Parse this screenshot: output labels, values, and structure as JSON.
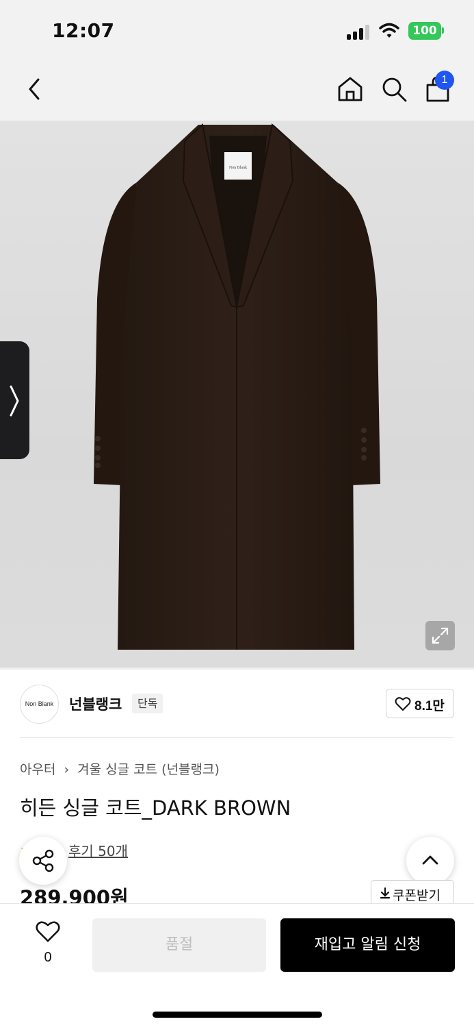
{
  "status_bar": {
    "time": "12:07",
    "battery": "100"
  },
  "nav": {
    "back_icon": "chevron-left-icon",
    "home_icon": "home-icon",
    "search_icon": "search-icon",
    "cart_icon": "shopping-bag-icon",
    "cart_badge": "1"
  },
  "product_image": {
    "label_text": "Non Blank",
    "side_tab_icon": "chevron-right-icon",
    "expand_icon": "expand-icon"
  },
  "brand": {
    "logo_text": "Non Blank",
    "name": "넌블랭크",
    "badge": "단독",
    "likes": "8.1만"
  },
  "breadcrumb": {
    "category": "아우터",
    "subcategory": "겨울 싱글 코트 (넌블랭크)"
  },
  "product": {
    "title": "히든 싱글 코트_DARK BROWN",
    "review_link": "후기 50개",
    "price": "289,900원",
    "coupon_label": "쿠폰받기"
  },
  "bottom_bar": {
    "wishlist_count": "0",
    "soldout_label": "품절",
    "restock_label": "재입고 알림 신청"
  },
  "colors": {
    "accent_badge": "#1f55f0",
    "battery": "#34c759",
    "coat": "#2a1d16",
    "primary_button": "#000000",
    "disabled_button": "#f0f0f0"
  }
}
